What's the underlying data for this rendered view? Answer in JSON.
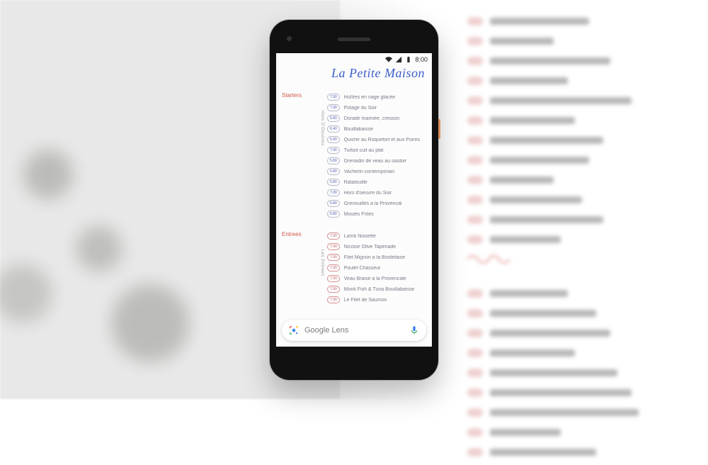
{
  "status": {
    "time": "8:00"
  },
  "restaurant_title": "La Petite Maison",
  "lens": {
    "label": "Google Lens"
  },
  "sections": [
    {
      "heading": "Starters",
      "side_label": "Hors D'Oeuvres",
      "items": [
        {
          "price": "7.90",
          "name": "Huîtres en nage glacée"
        },
        {
          "price": "7.90",
          "name": "Potage du Soir"
        },
        {
          "price": "5.80",
          "name": "Dorade marinée, cresson"
        },
        {
          "price": "6.40",
          "name": "Bouillabaisse"
        },
        {
          "price": "5.90",
          "name": "Quiche au Roquefort et aux Poires"
        },
        {
          "price": "7.90",
          "name": "Turbot cuit au plat"
        },
        {
          "price": "5.80",
          "name": "Grenadin de veau au sautoir"
        },
        {
          "price": "5.80",
          "name": "Vacherin contemporain"
        },
        {
          "price": "5.80",
          "name": "Ratatouille"
        },
        {
          "price": "7.90",
          "name": "Hors d'oeuvre du Soir"
        },
        {
          "price": "5.80",
          "name": "Grenouilles a la Provencal"
        },
        {
          "price": "6.80",
          "name": "Moules Frites"
        }
      ]
    },
    {
      "heading": "Entrees",
      "side_label": "Les Entrees",
      "items": [
        {
          "price": "7.90",
          "name": "Lamb Noisette"
        },
        {
          "price": "7.90",
          "name": "Nicoise Olive Tapenade"
        },
        {
          "price": "7.90",
          "name": "Filet Mignon a la Bordelaise"
        },
        {
          "price": "7.90",
          "name": "Poulet Chasseur"
        },
        {
          "price": "7.90",
          "name": "Veau Braise a la Provencale"
        },
        {
          "price": "7.90",
          "name": "Monk Fish & Tuna Bouillabaisse"
        },
        {
          "price": "7.90",
          "name": "Le Filet de Saumon"
        }
      ]
    }
  ]
}
